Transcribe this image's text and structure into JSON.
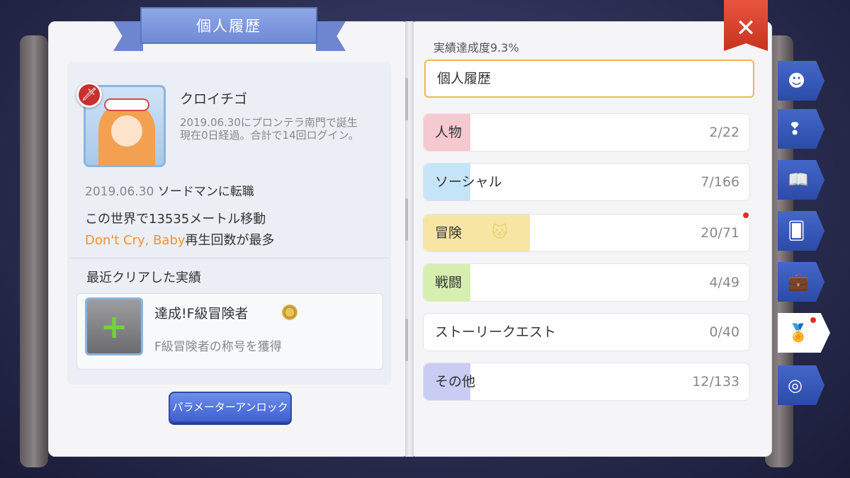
{
  "title": "個人履歴",
  "profile": {
    "name": "クロイチゴ",
    "born_line": "2019.06.30にプロンテラ南門で誕生",
    "login_line": "現在0日経過。合計で14回ログイン。",
    "job_date": "2019.06.30",
    "job_text": "ソードマンに転職",
    "move_text": "この世界で13535メートル移動",
    "song": "Don't Cry, Baby",
    "song_suffix": "再生回数が最多"
  },
  "recent": {
    "title": "最近クリアした実績",
    "achievement_name": "達成!F級冒険者",
    "achievement_desc": "F級冒険者の称号を獲得"
  },
  "unlock_button": "パラメーターアンロック",
  "completion": "実績達成度9.3%",
  "search_value": "個人履歴",
  "categories": [
    {
      "label": "人物",
      "count": "2/22",
      "color": "#f6c8cf"
    },
    {
      "label": "ソーシャル",
      "count": "7/166",
      "color": "#c6e4f7"
    },
    {
      "label": "冒険",
      "count": "20/71",
      "color": "#f7e6a3"
    },
    {
      "label": "戦闘",
      "count": "4/49",
      "color": "#d6efb0"
    },
    {
      "label": "ストーリークエスト",
      "count": "0/40",
      "color": "#ffffff"
    },
    {
      "label": "その他",
      "count": "12/133",
      "color": "#c9cdf4"
    }
  ],
  "side_tabs": [
    "face-icon",
    "alert-person-icon",
    "book-icon",
    "card-icon",
    "briefcase-heart-icon",
    "medal-icon",
    "compass-icon"
  ],
  "close_label": "✕"
}
